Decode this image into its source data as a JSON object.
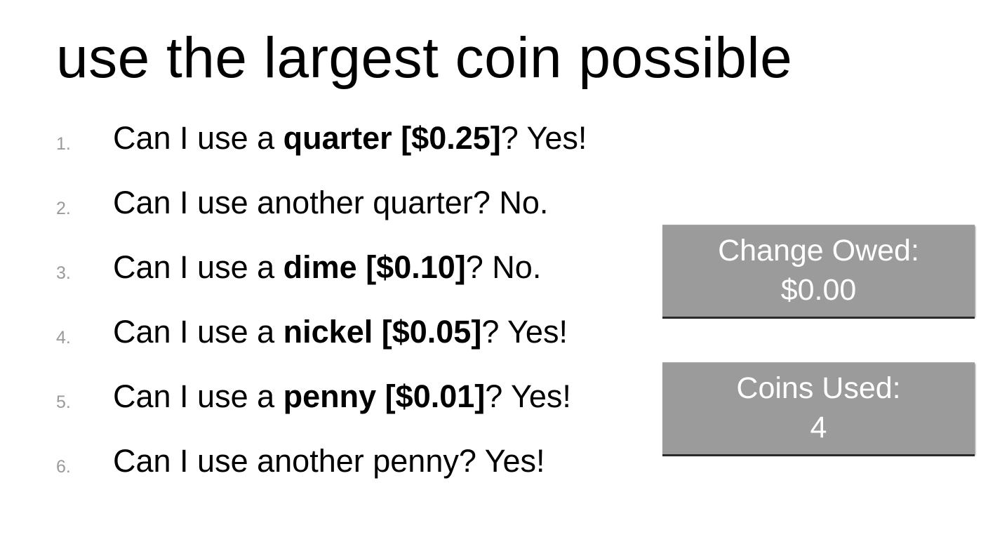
{
  "title": "use the largest coin possible",
  "steps": [
    {
      "num": "1.",
      "before": "Can I use a ",
      "bold": "quarter [$0.25]",
      "after": "? Yes!"
    },
    {
      "num": "2.",
      "before": "Can I use another quarter? No.",
      "bold": "",
      "after": ""
    },
    {
      "num": "3.",
      "before": "Can I use a ",
      "bold": "dime [$0.10]",
      "after": "? No."
    },
    {
      "num": "4.",
      "before": "Can I use a ",
      "bold": "nickel [$0.05]",
      "after": "? Yes!"
    },
    {
      "num": "5.",
      "before": "Can I use a ",
      "bold": "penny [$0.01]",
      "after": "? Yes!"
    },
    {
      "num": "6.",
      "before": "Can I use another penny? Yes!",
      "bold": "",
      "after": ""
    }
  ],
  "change_owed": {
    "label": "Change Owed:",
    "value": "$0.00"
  },
  "coins_used": {
    "label": "Coins Used:",
    "value": "4"
  },
  "colors": {
    "box_background": "#9b9b9b",
    "box_text": "#ffffff",
    "list_number": "#9a9a9a"
  }
}
